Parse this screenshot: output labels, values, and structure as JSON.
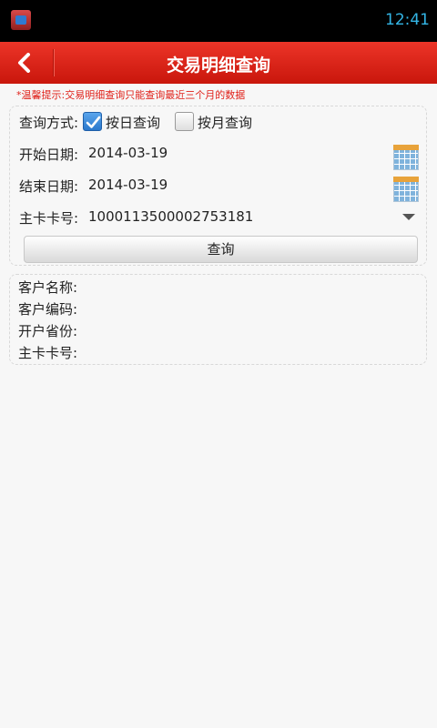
{
  "status_bar": {
    "time": "12:41",
    "app_icon": "photo-app-icon"
  },
  "header": {
    "title": "交易明细查询",
    "back_icon": "chevron-left-icon"
  },
  "tip": "*温馨提示:交易明细查询只能查询最近三个月的数据",
  "query": {
    "mode_label": "查询方式:",
    "options": [
      {
        "label": "按日查询",
        "checked": true
      },
      {
        "label": "按月查询",
        "checked": false
      }
    ],
    "start_date_label": "开始日期:",
    "start_date_value": "2014-03-19",
    "end_date_label": "结束日期:",
    "end_date_value": "2014-03-19",
    "card_label": "主卡卡号:",
    "card_value": "1000113500002753181",
    "submit_label": "查询",
    "calendar_icon": "calendar-icon",
    "dropdown_icon": "dropdown-arrow-icon"
  },
  "info": {
    "customer_name_label": "客户名称:",
    "customer_code_label": "客户编码:",
    "province_label": "开户省份:",
    "card_label": "主卡卡号:"
  },
  "colors": {
    "header_red": "#e32a1e",
    "tip_red": "#e0211a",
    "status_time": "#33b5e5",
    "checkbox_blue": "#2a78cc"
  }
}
